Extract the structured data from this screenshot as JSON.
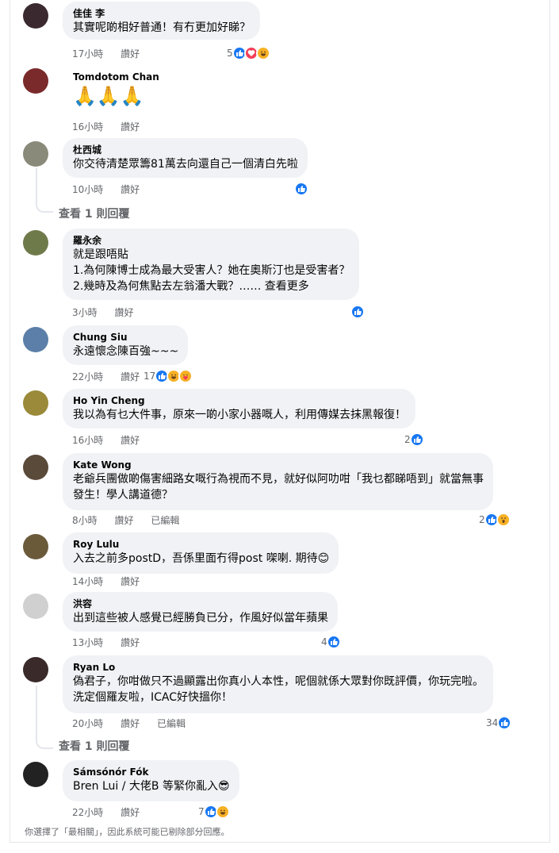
{
  "meta_labels": {
    "like": "讚好",
    "edited": "已編輯"
  },
  "comments": [
    {
      "name": "佳佳 李",
      "lines": [
        "其實呢啲相好普通！有冇更加好睇？"
      ],
      "time": "17小時",
      "count": "5",
      "reactions": [
        "like-icon",
        "love-icon",
        "haha-icon"
      ],
      "avatar_color": "#3a2a30"
    },
    {
      "name": "Tomdotom Chan",
      "lines": [
        "🙏🙏🙏"
      ],
      "time": "16小時",
      "count": "",
      "reactions": [],
      "avatar_color": "#7a2a2a"
    },
    {
      "name": "杜西城",
      "lines": [
        "你交待清楚眾籌81萬去向還自己一個清白先啦"
      ],
      "time": "10小時",
      "count": "",
      "reactions": [
        "like-icon"
      ],
      "avatar_color": "#8a8a7a"
    },
    {
      "name": "羅永余",
      "lines": [
        "就是跟唔貼",
        "1.為何陳博士成為最大受害人？她在奧斯汀也是受害者？",
        "2.幾時及為何焦點去左翁潘大戰？…… 查看更多"
      ],
      "time": "3小時",
      "count": "",
      "reactions": [
        "like-icon"
      ],
      "avatar_color": "#6f7a4a"
    },
    {
      "name": "Chung Siu",
      "lines": [
        "永遠懷念陳百強~~~"
      ],
      "time": "22小時",
      "count": "17",
      "reactions": [
        "like-icon",
        "haha-icon",
        "care-icon"
      ],
      "avatar_color": "#5b7fa8"
    },
    {
      "name": "Ho Yin Cheng",
      "lines": [
        "我以為有乜大件事，原來一啲小家小器嘅人，利用傳媒去抹黑報復！"
      ],
      "time": "16小時",
      "count": "2",
      "reactions": [
        "like-icon"
      ],
      "avatar_color": "#9a8a3a"
    },
    {
      "name": "Kate Wong",
      "lines": [
        "老爺兵團做啲傷害細路女嘅行為視而不見，就好似阿叻咁「我乜都睇唔到」就當無事",
        "發生！學人講道德？"
      ],
      "time": "8小時",
      "count": "2",
      "reactions": [
        "like-icon",
        "wow-icon"
      ],
      "avatar_color": "#5a4a3a"
    },
    {
      "name": "Roy Lulu",
      "lines": [
        "入去之前多postD，吾係里面冇得post 㗎喇. 期待😊"
      ],
      "time": "14小時",
      "count": "",
      "reactions": [],
      "avatar_color": "#6a5a3a"
    },
    {
      "name": "洪容",
      "lines": [
        "出到這些被人感覺已經勝負已分，作風好似當年蘋果"
      ],
      "time": "13小時",
      "count": "4",
      "reactions": [
        "like-icon"
      ],
      "avatar_color": "#d0d0d0"
    },
    {
      "name": "Ryan Lo",
      "lines": [
        "偽君子，你咁做只不過顯露出你真小人本性，呢個就係大眾對你既評價，你玩完啦。",
        "洗定個羅友啦，ICAC好快搵你！"
      ],
      "time": "20小時",
      "count": "34",
      "reactions": [
        "like-icon"
      ],
      "avatar_color": "#3a2a2a"
    },
    {
      "name": "Sámsónór Fók",
      "lines": [
        "Bren Lui / 大佬B 等緊你亂入😎"
      ],
      "time": "22小時",
      "count": "7",
      "reactions": [
        "like-icon",
        "haha-icon"
      ],
      "avatar_color": "#222222"
    }
  ],
  "replies": {
    "label": "查看 1 則回覆"
  },
  "footer": "你選擇了「最相關」，因此系統可能已剔除部分回應。",
  "colors": {
    "accent": "#1877f2",
    "bubble": "#f0f2f5",
    "muted": "#65676b"
  }
}
